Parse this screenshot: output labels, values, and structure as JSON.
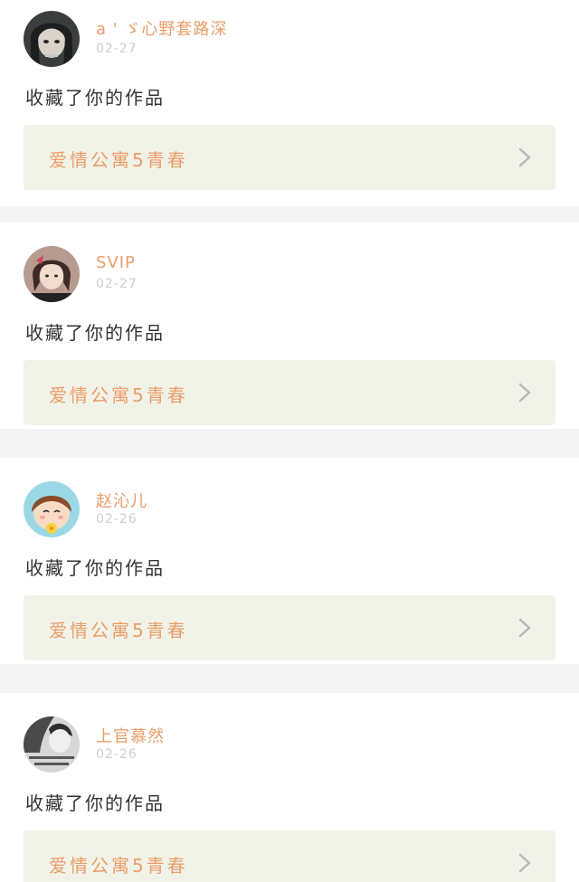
{
  "colors": {
    "accent": "#eb9d6a",
    "date": "#cfcfcf",
    "text": "#333333",
    "card_link_bg": "#f2f3e8",
    "separator": "#f4f4f4"
  },
  "feed": [
    {
      "username": "a ' ゞ心野套路深",
      "date": "02-27",
      "action": "收藏了你的作品",
      "work_title": "爱情公寓5青春",
      "avatar_icon": "user-avatar-dark-hair-icon",
      "chevron_icon": "chevron-right-icon"
    },
    {
      "username": "SVIP",
      "date": "02-27",
      "action": "收藏了你的作品",
      "work_title": "爱情公寓5青春",
      "avatar_icon": "user-avatar-girl-photo-icon",
      "chevron_icon": "chevron-right-icon"
    },
    {
      "username": "赵沁儿",
      "date": "02-26",
      "action": "收藏了你的作品",
      "work_title": "爱情公寓5青春",
      "avatar_icon": "user-avatar-cartoon-girl-icon",
      "chevron_icon": "chevron-right-icon"
    },
    {
      "username": "上官慕然",
      "date": "02-26",
      "action": "收藏了你的作品",
      "work_title": "爱情公寓5青春",
      "avatar_icon": "user-avatar-grayscale-icon",
      "chevron_icon": "chevron-right-icon"
    }
  ]
}
